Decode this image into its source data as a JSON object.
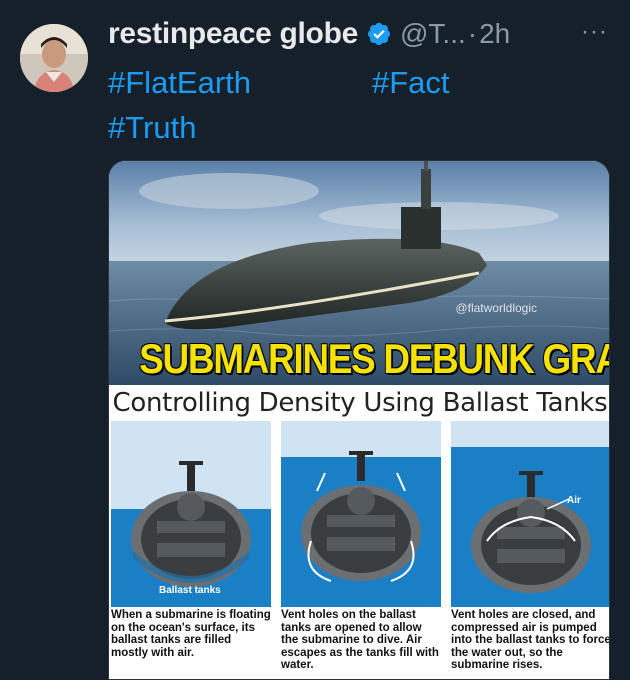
{
  "post": {
    "author_name": "restinpeace globe",
    "handle": "@T...",
    "separator": "·",
    "time": "2h",
    "more_label": "···",
    "hashtags": [
      "#FlatEarth",
      "#Fact",
      "#Truth"
    ]
  },
  "image": {
    "headline": "SUBMARINES DEBUNK GRAVITY",
    "watermark": "@flatworldlogic",
    "subtitle": "Controlling Density Using Ballast Tanks",
    "ballast_label": "Ballast tanks",
    "air_label": "Air",
    "captions": [
      "When a submarine is floating on the ocean's surface, its ballast tanks are filled mostly with air.",
      "Vent holes on the ballast tanks are opened to allow the submarine to dive. Air escapes as the tanks fill with water.",
      "Vent holes are closed, and compressed air is pumped into the ballast tanks to force the water out, so the submarine rises."
    ]
  },
  "colors": {
    "background": "#15202b",
    "link": "#1d9bf0",
    "verified": "#1d9bf0",
    "headline": "#f5e200"
  }
}
